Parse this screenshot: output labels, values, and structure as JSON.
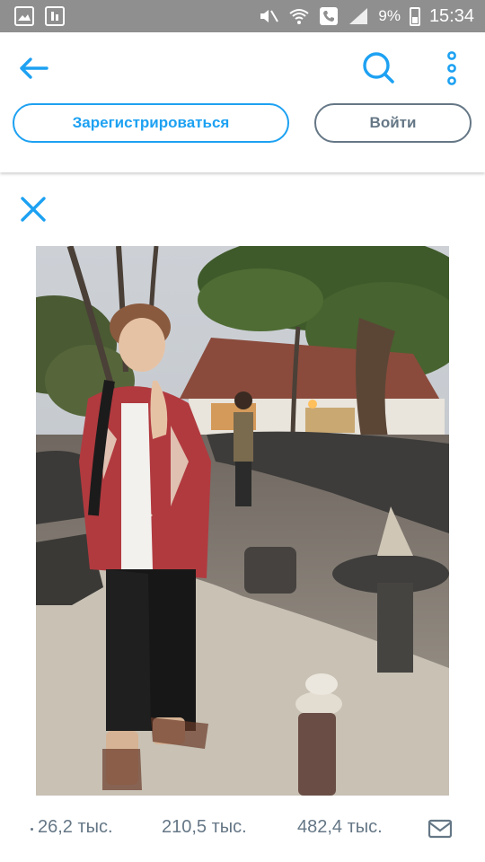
{
  "status_bar": {
    "battery": "9%",
    "time": "15:34"
  },
  "header": {
    "register_label": "Зарегистрироваться",
    "login_label": "Войти"
  },
  "colors": {
    "accent": "#1da1f2",
    "secondary": "#657786",
    "status_bar_bg": "#8f8f8f"
  },
  "icons": {
    "back": "arrow-left-icon",
    "search": "search-icon",
    "more": "more-vertical-icon",
    "close": "close-icon",
    "message": "envelope-icon"
  },
  "stats": {
    "replies": "26,2 тыс.",
    "retweets": "210,5 тыс.",
    "likes": "482,4 тыс."
  }
}
